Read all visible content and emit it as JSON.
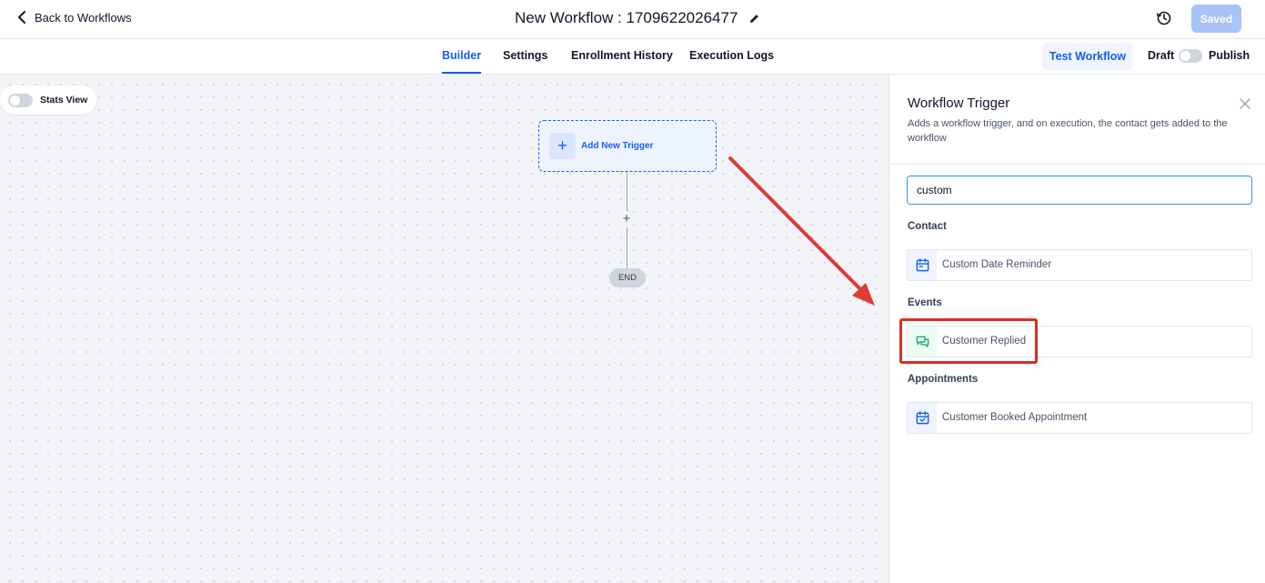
{
  "header": {
    "back_label": "Back to Workflows",
    "workflow_title": "New Workflow : 1709622026477",
    "saved_label": "Saved"
  },
  "tabs": [
    {
      "label": "Builder",
      "active": true
    },
    {
      "label": "Settings",
      "active": false
    },
    {
      "label": "Enrollment History",
      "active": false
    },
    {
      "label": "Execution Logs",
      "active": false
    }
  ],
  "toolbar": {
    "test_label": "Test Workflow",
    "draft_label": "Draft",
    "publish_label": "Publish",
    "publish_on": false
  },
  "canvas": {
    "stats_view_label": "Stats View",
    "stats_view_on": false,
    "trigger_label": "Add New Trigger",
    "add_step_symbol": "+",
    "end_label": "END"
  },
  "panel": {
    "title": "Workflow Trigger",
    "description": "Adds a workflow trigger, and on execution, the contact gets added to the workflow",
    "search_value": "custom",
    "sections": [
      {
        "label": "Contact",
        "options": [
          {
            "label": "Custom Date Reminder",
            "icon": "calendar-icon"
          }
        ]
      },
      {
        "label": "Events",
        "options": [
          {
            "label": "Customer Replied",
            "icon": "chat-bubbles-icon"
          }
        ]
      },
      {
        "label": "Appointments",
        "options": [
          {
            "label": "Customer Booked Appointment",
            "icon": "calendar-check-icon"
          }
        ]
      }
    ]
  },
  "colors": {
    "accent": "#155eef",
    "annotation": "#d92d20",
    "event_icon": "#12b76a"
  }
}
